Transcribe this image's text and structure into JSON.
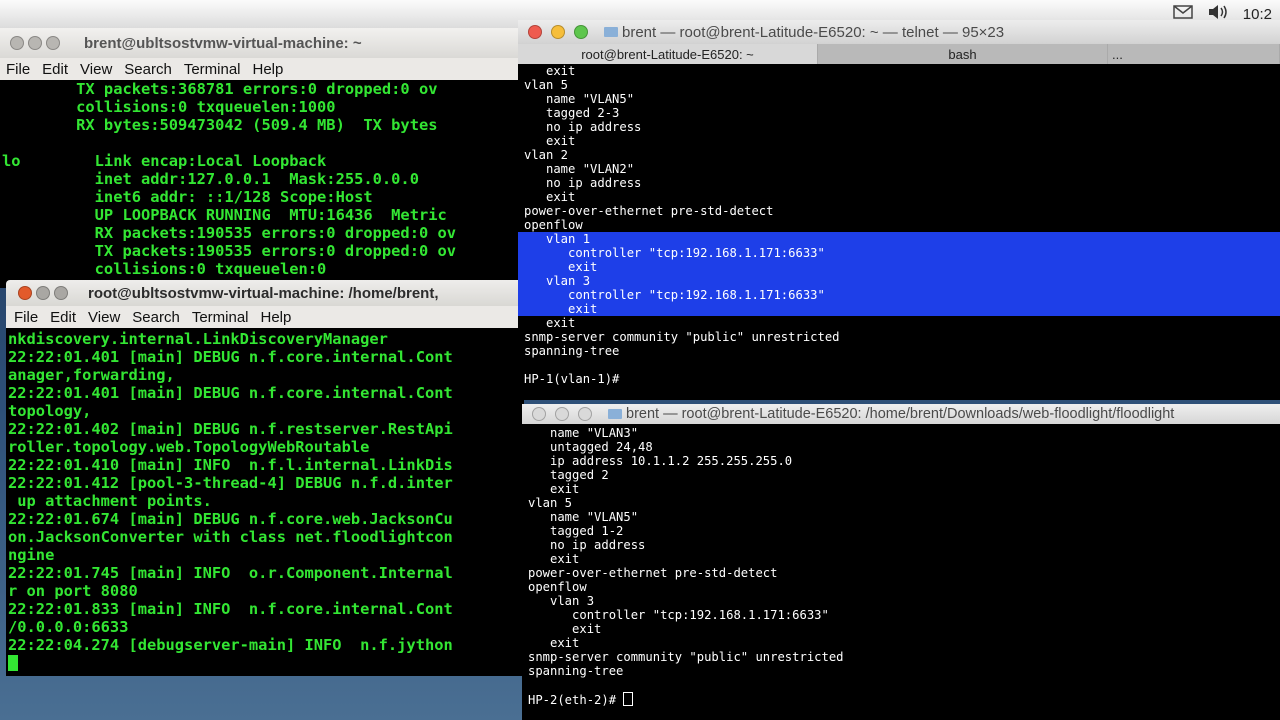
{
  "tray": {
    "clock": "10:2",
    "mail_icon": "mail-icon",
    "volume_icon": "volume-icon"
  },
  "win1": {
    "title": "brent@ubltsostvmw-virtual-machine: ~",
    "menu": [
      "File",
      "Edit",
      "View",
      "Search",
      "Terminal",
      "Help"
    ],
    "lines": [
      "        TX packets:368781 errors:0 dropped:0 ov",
      "        collisions:0 txqueuelen:1000",
      "        RX bytes:509473042 (509.4 MB)  TX bytes",
      "",
      "lo        Link encap:Local Loopback",
      "          inet addr:127.0.0.1  Mask:255.0.0.0",
      "          inet6 addr: ::1/128 Scope:Host",
      "          UP LOOPBACK RUNNING  MTU:16436  Metric",
      "          RX packets:190535 errors:0 dropped:0 ov",
      "          TX packets:190535 errors:0 dropped:0 ov",
      "          collisions:0 txqueuelen:0"
    ]
  },
  "win2": {
    "title": "root@ubltsostvmw-virtual-machine: /home/brent,",
    "menu": [
      "File",
      "Edit",
      "View",
      "Search",
      "Terminal",
      "Help"
    ],
    "lines": [
      "nkdiscovery.internal.LinkDiscoveryManager",
      "22:22:01.401 [main] DEBUG n.f.core.internal.Cont",
      "anager,forwarding,",
      "22:22:01.401 [main] DEBUG n.f.core.internal.Cont",
      "topology,",
      "22:22:01.402 [main] DEBUG n.f.restserver.RestApi",
      "roller.topology.web.TopologyWebRoutable",
      "22:22:01.410 [main] INFO  n.f.l.internal.LinkDis",
      "22:22:01.412 [pool-3-thread-4] DEBUG n.f.d.inter",
      " up attachment points.",
      "22:22:01.674 [main] DEBUG n.f.core.web.JacksonCu",
      "on.JacksonConverter with class net.floodlightcon",
      "ngine",
      "22:22:01.745 [main] INFO  o.r.Component.Internal",
      "r on port 8080",
      "22:22:01.833 [main] INFO  n.f.core.internal.Cont",
      "/0.0.0.0:6633",
      "22:22:04.274 [debugserver-main] INFO  n.f.jython"
    ]
  },
  "win3": {
    "title": "brent — root@brent-Latitude-E6520: ~ — telnet — 95×23",
    "tabs": [
      "root@brent-Latitude-E6520: ~",
      "bash",
      "..."
    ],
    "lines_top": [
      "   exit",
      "vlan 5",
      "   name \"VLAN5\"",
      "   tagged 2-3",
      "   no ip address",
      "   exit",
      "vlan 2",
      "   name \"VLAN2\"",
      "   no ip address",
      "   exit",
      "power-over-ethernet pre-std-detect",
      "openflow"
    ],
    "lines_highlight": [
      "   vlan 1",
      "      controller \"tcp:192.168.1.171:6633\"",
      "      exit",
      "   vlan 3",
      "      controller \"tcp:192.168.1.171:6633\"",
      "      exit"
    ],
    "lines_bottom": [
      "   exit",
      "snmp-server community \"public\" unrestricted",
      "spanning-tree",
      "",
      "HP-1(vlan-1)#"
    ]
  },
  "win4": {
    "title": "brent — root@brent-Latitude-E6520: /home/brent/Downloads/web-floodlight/floodlight",
    "lines": [
      "   name \"VLAN3\"",
      "   untagged 24,48",
      "   ip address 10.1.1.2 255.255.255.0",
      "   tagged 2",
      "   exit",
      "vlan 5",
      "   name \"VLAN5\"",
      "   tagged 1-2",
      "   no ip address",
      "   exit",
      "power-over-ethernet pre-std-detect",
      "openflow",
      "   vlan 3",
      "      controller \"tcp:192.168.1.171:6633\"",
      "      exit",
      "   exit",
      "snmp-server community \"public\" unrestricted",
      "spanning-tree",
      ""
    ],
    "prompt": "HP-2(eth-2)# "
  },
  "colors": {
    "ubuntu_close": "#e25a2b",
    "ubuntu_btn": "#a9a7a3",
    "mac_close": "#ef5b4f",
    "mac_min": "#f6be3b",
    "mac_max": "#5ec64d",
    "term_green": "#33e633",
    "selection": "#1e3fe8"
  }
}
